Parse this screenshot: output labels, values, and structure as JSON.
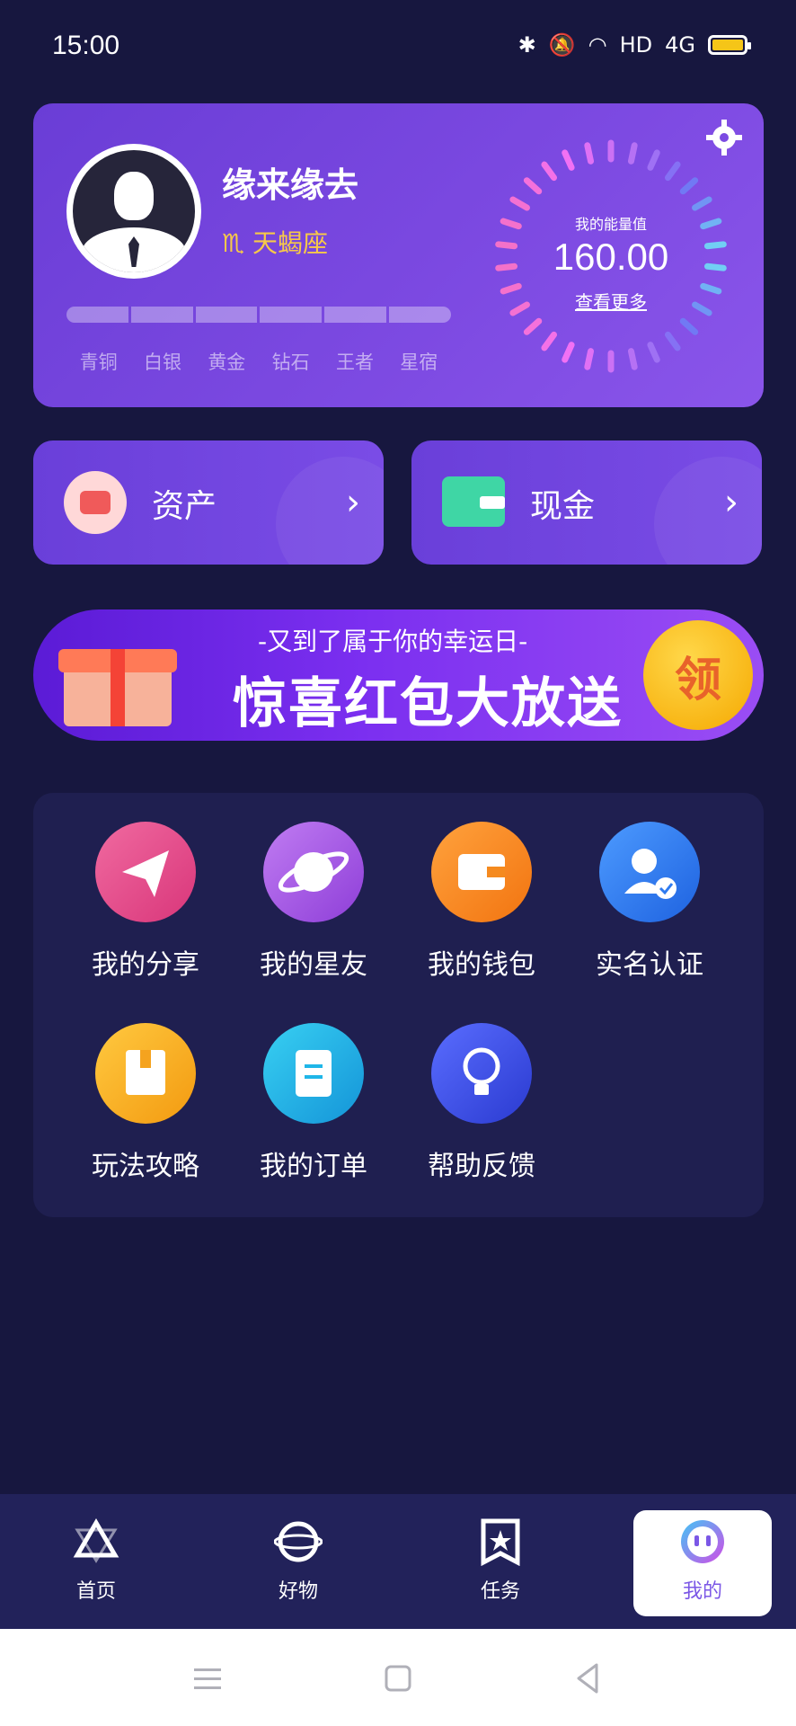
{
  "status": {
    "time": "15:00",
    "network": "HD",
    "signal": "4G"
  },
  "profile": {
    "username": "缘来缘去",
    "zodiac": "♏ 天蝎座",
    "levels": [
      "青铜",
      "白银",
      "黄金",
      "钻石",
      "王者",
      "星宿"
    ],
    "energy_label": "我的能量值",
    "energy_value": "160.00",
    "energy_more": "查看更多"
  },
  "cards": {
    "assets_label": "资产",
    "cash_label": "现金"
  },
  "banner": {
    "subtitle": "-又到了属于你的幸运日-",
    "title": "惊喜红包大放送",
    "claim_label": "领"
  },
  "menu": [
    {
      "label": "我的分享",
      "icon": "paper-plane-icon",
      "color": "#e94a8a"
    },
    {
      "label": "我的星友",
      "icon": "planet-icon",
      "color": "#a456e8"
    },
    {
      "label": "我的钱包",
      "icon": "wallet-icon",
      "color": "#f58a1f"
    },
    {
      "label": "实名认证",
      "icon": "verified-user-icon",
      "color": "#2f7bf0"
    },
    {
      "label": "玩法攻略",
      "icon": "guide-book-icon",
      "color": "#f5a31f"
    },
    {
      "label": "我的订单",
      "icon": "clipboard-icon",
      "color": "#1fb6e8"
    },
    {
      "label": "帮助反馈",
      "icon": "lightbulb-icon",
      "color": "#3a56e6"
    }
  ],
  "tabs": [
    {
      "label": "首页",
      "icon": "triangle-star-icon"
    },
    {
      "label": "好物",
      "icon": "planet-ring-icon"
    },
    {
      "label": "任务",
      "icon": "bookmark-star-icon"
    },
    {
      "label": "我的",
      "icon": "face-icon",
      "active": true
    }
  ],
  "colors": {
    "background": "#17173f",
    "accent": "#7b57e6",
    "zodiac": "#f7c948"
  }
}
